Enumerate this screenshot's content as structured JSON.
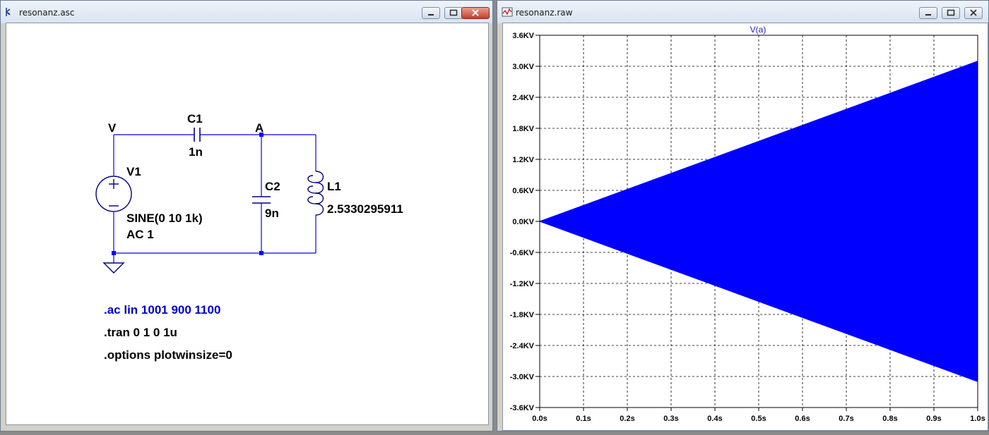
{
  "schematic": {
    "title": "resonanz.asc",
    "labels": {
      "node_v": "V",
      "node_a": "A",
      "c1_name": "C1",
      "c1_value": "1n",
      "c2_name": "C2",
      "c2_value": "9n",
      "l1_name": "L1",
      "l1_value": "2.5330295911",
      "v1_name": "V1",
      "v1_value": "SINE(0 10 1k)",
      "v1_ac": "AC 1"
    },
    "directives": {
      "ac": ".ac lin 1001 900 1100",
      "tran": ".tran 0 1 0 1u",
      "options": ".options plotwinsize=0"
    },
    "colors": {
      "wire": "#0000ff",
      "component": "#000080",
      "directive_ac": "#0000c8",
      "text": "#000000"
    }
  },
  "waveform": {
    "title": "resonanz.raw",
    "trace_color": "#0000ff",
    "chart_data": {
      "type": "area",
      "title": "V(a)",
      "x_ticks": [
        "0.0s",
        "0.1s",
        "0.2s",
        "0.3s",
        "0.4s",
        "0.5s",
        "0.6s",
        "0.7s",
        "0.8s",
        "0.9s",
        "1.0s"
      ],
      "y_ticks": [
        "3.6KV",
        "3.0KV",
        "2.4KV",
        "1.8KV",
        "1.2KV",
        "0.6KV",
        "0.0KV",
        "-0.6KV",
        "-1.2KV",
        "-1.8KV",
        "-2.4KV",
        "-3.0KV",
        "-3.6KV"
      ],
      "xlim": [
        0,
        1.0
      ],
      "ylim": [
        -3600,
        3600
      ],
      "grid": true,
      "series": [
        {
          "x": [
            0.0,
            1.0
          ],
          "upper": [
            0,
            3100
          ],
          "lower": [
            0,
            -3100
          ]
        }
      ]
    }
  }
}
